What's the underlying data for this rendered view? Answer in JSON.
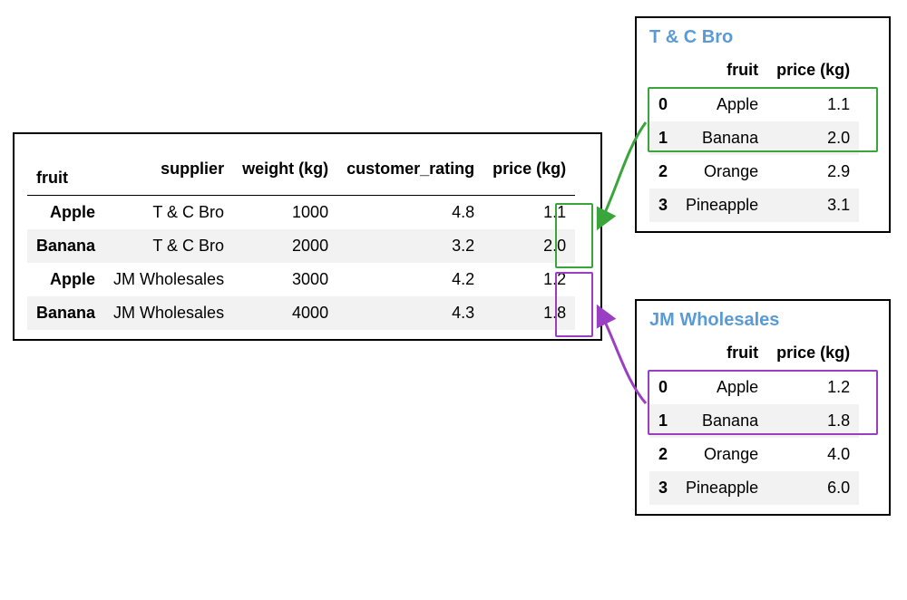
{
  "main_table": {
    "index_label": "fruit",
    "headers": [
      "supplier",
      "weight (kg)",
      "customer_rating",
      "price (kg)"
    ],
    "rows": [
      {
        "fruit": "Apple",
        "supplier": "T & C Bro",
        "weight": "1000",
        "rating": "4.8",
        "price": "1.1"
      },
      {
        "fruit": "Banana",
        "supplier": "T & C Bro",
        "weight": "2000",
        "rating": "3.2",
        "price": "2.0"
      },
      {
        "fruit": "Apple",
        "supplier": "JM Wholesales",
        "weight": "3000",
        "rating": "4.2",
        "price": "1.2"
      },
      {
        "fruit": "Banana",
        "supplier": "JM Wholesales",
        "weight": "4000",
        "rating": "4.3",
        "price": "1.8"
      }
    ]
  },
  "supplier_tables": {
    "tc": {
      "title": "T & C Bro",
      "headers": [
        "fruit",
        "price (kg)"
      ],
      "rows": [
        {
          "idx": "0",
          "fruit": "Apple",
          "price": "1.1"
        },
        {
          "idx": "1",
          "fruit": "Banana",
          "price": "2.0"
        },
        {
          "idx": "2",
          "fruit": "Orange",
          "price": "2.9"
        },
        {
          "idx": "3",
          "fruit": "Pineapple",
          "price": "3.1"
        }
      ]
    },
    "jm": {
      "title": "JM Wholesales",
      "headers": [
        "fruit",
        "price (kg)"
      ],
      "rows": [
        {
          "idx": "0",
          "fruit": "Apple",
          "price": "1.2"
        },
        {
          "idx": "1",
          "fruit": "Banana",
          "price": "1.8"
        },
        {
          "idx": "2",
          "fruit": "Orange",
          "price": "4.0"
        },
        {
          "idx": "3",
          "fruit": "Pineapple",
          "price": "6.0"
        }
      ]
    }
  },
  "colors": {
    "title": "#5a9bd5",
    "green": "#3aa53a",
    "purple": "#9b3fc2"
  },
  "chart_data": {
    "type": "table",
    "description": "Pandas-style DataFrame diagram showing price(kg) lookup from two supplier price tables into a combined table indexed by fruit.",
    "main": [
      {
        "fruit": "Apple",
        "supplier": "T & C Bro",
        "weight_kg": 1000,
        "customer_rating": 4.8,
        "price_kg": 1.1
      },
      {
        "fruit": "Banana",
        "supplier": "T & C Bro",
        "weight_kg": 2000,
        "customer_rating": 3.2,
        "price_kg": 2.0
      },
      {
        "fruit": "Apple",
        "supplier": "JM Wholesales",
        "weight_kg": 3000,
        "customer_rating": 4.2,
        "price_kg": 1.2
      },
      {
        "fruit": "Banana",
        "supplier": "JM Wholesales",
        "weight_kg": 4000,
        "customer_rating": 4.3,
        "price_kg": 1.8
      }
    ],
    "suppliers": {
      "T & C Bro": [
        {
          "fruit": "Apple",
          "price_kg": 1.1
        },
        {
          "fruit": "Banana",
          "price_kg": 2.0
        },
        {
          "fruit": "Orange",
          "price_kg": 2.9
        },
        {
          "fruit": "Pineapple",
          "price_kg": 3.1
        }
      ],
      "JM Wholesales": [
        {
          "fruit": "Apple",
          "price_kg": 1.2
        },
        {
          "fruit": "Banana",
          "price_kg": 1.8
        },
        {
          "fruit": "Orange",
          "price_kg": 4.0
        },
        {
          "fruit": "Pineapple",
          "price_kg": 6.0
        }
      ]
    },
    "highlights": [
      {
        "color": "green",
        "source": "T & C Bro rows 0-1",
        "target": "main price rows 0-1"
      },
      {
        "color": "purple",
        "source": "JM Wholesales rows 0-1",
        "target": "main price rows 2-3"
      }
    ]
  }
}
